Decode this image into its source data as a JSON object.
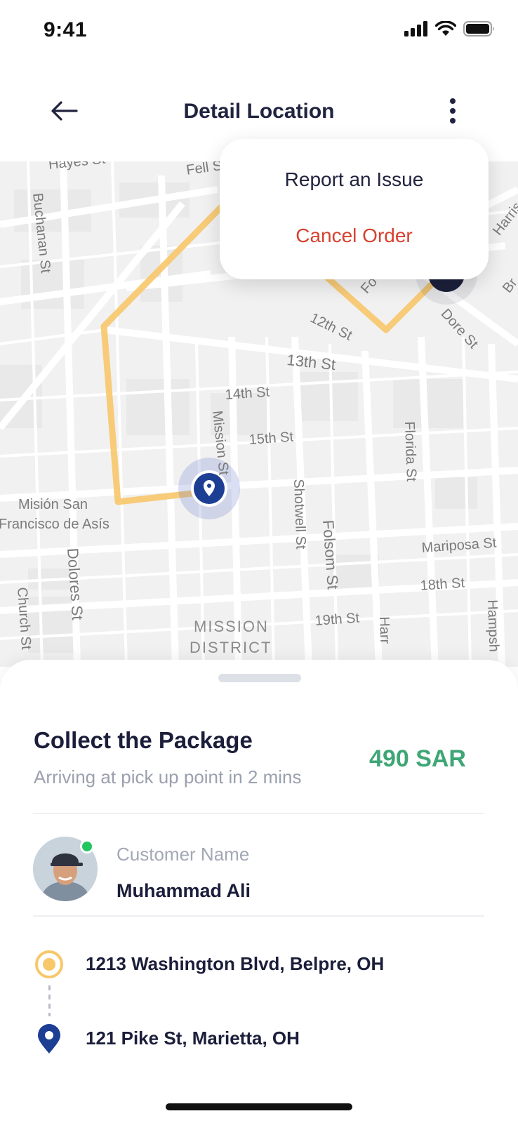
{
  "status_bar": {
    "time": "9:41"
  },
  "header": {
    "title": "Detail Location"
  },
  "menu": {
    "report": "Report an Issue",
    "cancel": "Cancel Order"
  },
  "map": {
    "labels": {
      "hayes": "Hayes St",
      "fell": "Fell St",
      "buchanan": "Buchanan St",
      "harrison_top": "Harris",
      "folsom_top": "Fo",
      "bryant": "Br",
      "st12": "12th St",
      "dore": "Dore St",
      "st13": "13th St",
      "st14": "14th St",
      "mission": "Mission St",
      "st15": "15th St",
      "florida": "Florida St",
      "mision_1": "Misión San",
      "mision_2": "Francisco de Asís",
      "shotwell": "Shotwell St",
      "folsom": "Folsom St",
      "mariposa": "Mariposa St",
      "dolores": "Dolores St",
      "st18": "18th St",
      "church": "Church St",
      "mission_district_1": "MISSION",
      "mission_district_2": "DISTRICT",
      "st19": "19th St",
      "harrison": "Harr",
      "hampshire": "Hampsh"
    },
    "colors": {
      "route": "#f7c76a",
      "pin": "#1c3f94"
    }
  },
  "order": {
    "title": "Collect the Package",
    "subtitle": "Arriving at pick up point in 2 mins",
    "price": "490 SAR",
    "customer_label": "Customer Name",
    "customer_name": "Muhammad Ali",
    "pickup_address": "1213 Washington Blvd, Belpre, OH",
    "dropoff_address": "121 Pike St, Marietta, OH"
  },
  "colors": {
    "accent_green": "#3fa676",
    "cancel_red": "#d8412f",
    "online": "#22c55e"
  }
}
